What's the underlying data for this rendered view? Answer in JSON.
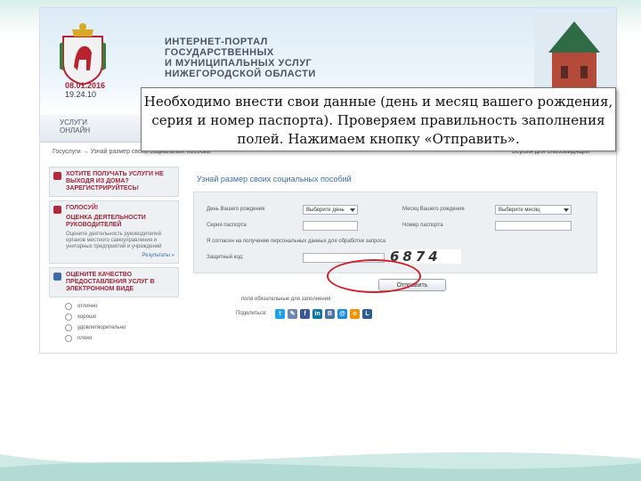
{
  "header": {
    "date": "08.01.2016",
    "time": "19.24.10",
    "portal_title": "ИНТЕРНЕТ-ПОРТАЛ\nГОСУДАРСТВЕННЫХ\nИ МУНИЦИПАЛЬНЫХ УСЛУГ\nНИЖЕГОРОДСКОЙ ОБЛАСТИ"
  },
  "nav": {
    "tab_services": "УСЛУГИ\nОНЛАЙН"
  },
  "breadcrumb": {
    "left": "Госуслуги → Узнай размер своих социальных пособий",
    "right": "Версия для слабовидящих"
  },
  "sidebar": {
    "block1": "ХОТИТЕ ПОЛУЧАТЬ УСЛУГИ НЕ ВЫХОДЯ ИЗ ДОМА? ЗАРЕГИСТРИРУЙТЕСЬ!",
    "block2_title": "ГОЛОСУЙ!",
    "block2_sub": "ОЦЕНКА ДЕЯТЕЛЬНОСТИ РУКОВОДИТЕЛЕЙ",
    "block2_note": "Оцените деятельность руководителей органов местного самоуправления и унитарных предприятий и учреждений",
    "block2_link": "Результаты »",
    "block3": "ОЦЕНИТЕ КАЧЕСТВО ПРЕДОСТАВЛЕНИЯ УСЛУГ В ЭЛЕКТРОННОМ ВИДЕ",
    "options": [
      "отлично",
      "хорошо",
      "удовлетворительно",
      "плохо"
    ]
  },
  "form": {
    "title": "Узнай размер своих социальных пособий",
    "birth_day_label": "День Вашего рождения",
    "birth_day_value": "Выберите день",
    "birth_month_label": "Месяц Вашего рождения",
    "birth_month_value": "Выберите месяц",
    "series_label": "Серия паспорта",
    "number_label": "Номер паспорта",
    "consent_label": "Я согласен на получение персональных данных для обработки запроса",
    "captcha_label": "Защитный код:",
    "captcha_text": "6874",
    "send_button": "Отправить",
    "required_note": "поля обязательные для заполнения",
    "share_label": "Поделиться:"
  },
  "share_icons": [
    {
      "name": "twitter-icon",
      "glyph": "t",
      "color": "#1da1f2"
    },
    {
      "name": "bookmark-icon",
      "glyph": "✎",
      "color": "#6c8ab0"
    },
    {
      "name": "facebook-icon",
      "glyph": "f",
      "color": "#3b5998"
    },
    {
      "name": "linkedin-icon",
      "glyph": "in",
      "color": "#0e76a8"
    },
    {
      "name": "vkontakte-icon",
      "glyph": "B",
      "color": "#4c75a3"
    },
    {
      "name": "mail-icon",
      "glyph": "@",
      "color": "#168de2"
    },
    {
      "name": "odnoklassniki-icon",
      "glyph": "o",
      "color": "#f29400"
    },
    {
      "name": "livejournal-icon",
      "glyph": "L",
      "color": "#2e5f8c"
    }
  ],
  "callout": {
    "text": "Необходимо внести свои данные (день и месяц вашего рождения, серия и номер паспорта). Проверяем правильность заполнения полей. Нажимаем кнопку «Отправить»."
  },
  "colors": {
    "accent_red": "#d21e2b",
    "link_blue": "#3d6ea6",
    "sidebar_red": "#a3263a"
  }
}
